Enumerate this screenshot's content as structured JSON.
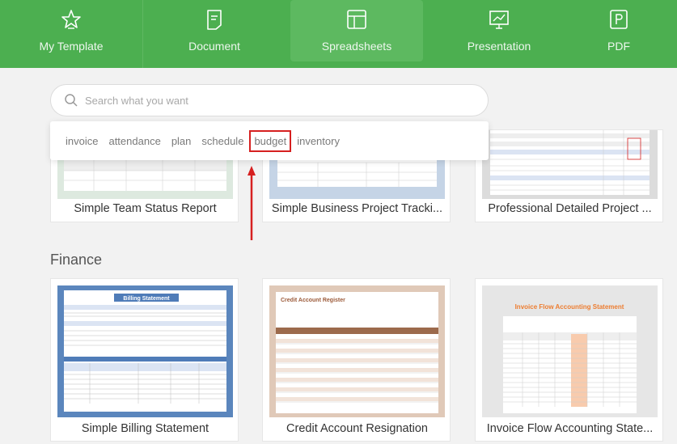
{
  "nav": {
    "items": [
      {
        "label": "My Template",
        "icon": "star-icon"
      },
      {
        "label": "Document",
        "icon": "document-icon"
      },
      {
        "label": "Spreadsheets",
        "icon": "spreadsheet-icon"
      },
      {
        "label": "Presentation",
        "icon": "presentation-icon"
      },
      {
        "label": "PDF",
        "icon": "pdf-icon"
      }
    ],
    "active": "Spreadsheets"
  },
  "search": {
    "placeholder": "Search what you want",
    "suggestions": [
      "invoice",
      "attendance",
      "plan",
      "schedule",
      "budget",
      "inventory"
    ],
    "highlighted": "budget"
  },
  "top_row": {
    "cards": [
      {
        "title": "Simple Team Status Report"
      },
      {
        "title": "Simple Business Project Tracki..."
      },
      {
        "title": "Professional Detailed Project ..."
      }
    ]
  },
  "finance": {
    "title": "Finance",
    "cards": [
      {
        "title": "Simple Billing Statement",
        "thumb_heading": "Billing Statement"
      },
      {
        "title": "Credit Account Resignation",
        "thumb_heading": "Credit Account Register"
      },
      {
        "title": "Invoice Flow Accounting State...",
        "thumb_heading": "Invoice Flow Accounting Statement"
      }
    ]
  },
  "colors": {
    "brand_green": "#4caf50",
    "highlight_red": "#d62020"
  }
}
